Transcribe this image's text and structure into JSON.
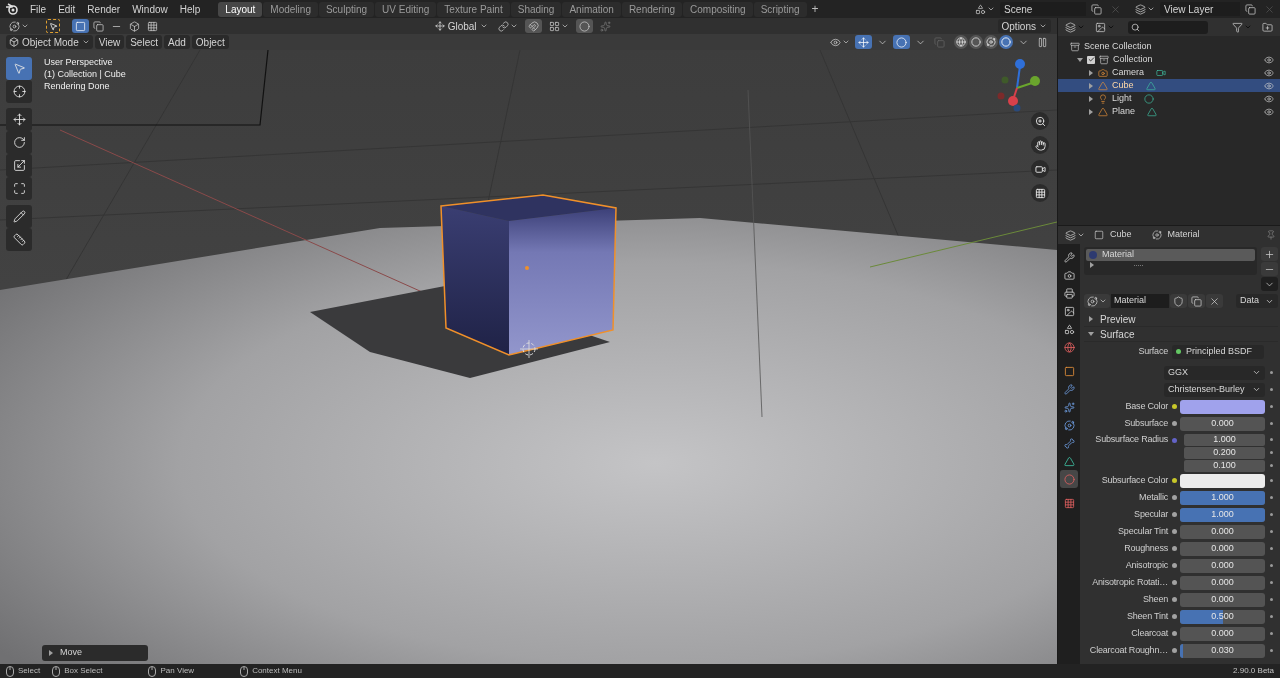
{
  "top_bar": {
    "menus": [
      "File",
      "Edit",
      "Render",
      "Window",
      "Help"
    ],
    "workspaces": [
      {
        "label": "Layout",
        "selected": true
      },
      {
        "label": "Modeling",
        "selected": false
      },
      {
        "label": "Sculpting",
        "selected": false
      },
      {
        "label": "UV Editing",
        "selected": false
      },
      {
        "label": "Texture Paint",
        "selected": false
      },
      {
        "label": "Shading",
        "selected": false
      },
      {
        "label": "Animation",
        "selected": false
      },
      {
        "label": "Rendering",
        "selected": false
      },
      {
        "label": "Compositing",
        "selected": false
      },
      {
        "label": "Scripting",
        "selected": false
      }
    ],
    "add_tab": "+",
    "scene": "Scene",
    "view_layer": "View Layer"
  },
  "tool_header": {
    "transform_orientation": "Global",
    "options": "Options"
  },
  "viewport_header": {
    "mode": "Object Mode",
    "menus": [
      "View",
      "Select",
      "Add",
      "Object"
    ],
    "shading_modes": [
      {
        "kind": "wireframe",
        "selected": false
      },
      {
        "kind": "solid",
        "selected": false
      },
      {
        "kind": "material",
        "selected": false
      },
      {
        "kind": "rendered",
        "selected": true
      }
    ]
  },
  "viewport": {
    "info": [
      "User Perspective",
      "(1) Collection | Cube",
      "Rendering Done"
    ],
    "tools": [
      {
        "kind": "select",
        "selected": true
      },
      {
        "kind": "cursor",
        "selected": false
      },
      {
        "kind": "move",
        "selected": false
      },
      {
        "kind": "rotate",
        "selected": false
      },
      {
        "kind": "scale",
        "selected": false
      },
      {
        "kind": "transform",
        "selected": false
      },
      {
        "kind": "annotate",
        "selected": false
      },
      {
        "kind": "measure",
        "selected": false
      }
    ],
    "last_operator": {
      "label": "Move",
      "expanded": false
    }
  },
  "outliner": {
    "tree": {
      "label": "Scene Collection",
      "children": [
        {
          "label": "Collection",
          "kind": "collection",
          "checked": true,
          "expanded": true,
          "visible": true,
          "selected": false,
          "children": [
            {
              "label": "Camera",
              "kind": "camera",
              "expanded": false,
              "visible": true,
              "selected": false
            },
            {
              "label": "Cube",
              "kind": "mesh",
              "expanded": false,
              "visible": true,
              "selected": true
            },
            {
              "label": "Light",
              "kind": "light",
              "expanded": false,
              "visible": true,
              "selected": false
            },
            {
              "label": "Plane",
              "kind": "mesh",
              "expanded": false,
              "visible": true,
              "selected": false
            }
          ]
        }
      ]
    }
  },
  "properties": {
    "object": "Cube",
    "context": "Material",
    "tabs": [
      {
        "kind": "tool",
        "selected": false
      },
      {
        "kind": "render",
        "selected": false
      },
      {
        "kind": "output",
        "selected": false
      },
      {
        "kind": "view_layer",
        "selected": false
      },
      {
        "kind": "scene",
        "selected": false
      },
      {
        "kind": "world",
        "selected": false
      },
      {
        "kind": "object",
        "selected": false
      },
      {
        "kind": "modifiers",
        "selected": false
      },
      {
        "kind": "particles",
        "selected": false
      },
      {
        "kind": "physics",
        "selected": false
      },
      {
        "kind": "constraints",
        "selected": false
      },
      {
        "kind": "data",
        "selected": false
      },
      {
        "kind": "material",
        "selected": true
      },
      {
        "kind": "texture",
        "selected": false
      }
    ],
    "slots": [
      {
        "label": "Material",
        "selected": true
      }
    ],
    "datablock": "Material",
    "link": "Data",
    "panels": [
      {
        "label": "Preview",
        "expanded": false
      },
      {
        "label": "Surface",
        "expanded": true
      }
    ],
    "rows": [
      {
        "kind": "shader",
        "label": "Surface",
        "value": "Principled BSDF"
      },
      {
        "kind": "enum",
        "value": "GGX"
      },
      {
        "kind": "enum",
        "value": "Christensen-Burley"
      },
      {
        "kind": "color",
        "label": "Base Color",
        "color": "#a0a2ec"
      },
      {
        "kind": "value",
        "label": "Subsurface",
        "value": "0.000",
        "level": 0
      },
      {
        "kind": "vector",
        "label": "Subsurface Radius",
        "values": [
          "1.000",
          "0.200",
          "0.100"
        ]
      },
      {
        "kind": "color",
        "label": "Subsurface Color",
        "color": "#ececec"
      },
      {
        "kind": "value",
        "label": "Metallic",
        "value": "1.000",
        "level": 1
      },
      {
        "kind": "value",
        "label": "Specular",
        "value": "1.000",
        "level": 1
      },
      {
        "kind": "value",
        "label": "Specular Tint",
        "value": "0.000",
        "level": 0
      },
      {
        "kind": "value",
        "label": "Roughness",
        "value": "0.000",
        "level": 0
      },
      {
        "kind": "value",
        "label": "Anisotropic",
        "value": "0.000",
        "level": 0
      },
      {
        "kind": "value",
        "label": "Anisotropic Rotati…",
        "value": "0.000",
        "level": 0
      },
      {
        "kind": "value",
        "label": "Sheen",
        "value": "0.000",
        "level": 0
      },
      {
        "kind": "value",
        "label": "Sheen Tint",
        "value": "0.500",
        "level": 0.5
      },
      {
        "kind": "value",
        "label": "Clearcoat",
        "value": "0.000",
        "level": 0
      },
      {
        "kind": "value",
        "label": "Clearcoat Roughn…",
        "value": "0.030",
        "level": 0.03
      }
    ]
  },
  "status_bar": {
    "hints": [
      "Select",
      "Box Select",
      "Pan View",
      "Context Menu"
    ],
    "version": "2.90.0 Beta"
  }
}
